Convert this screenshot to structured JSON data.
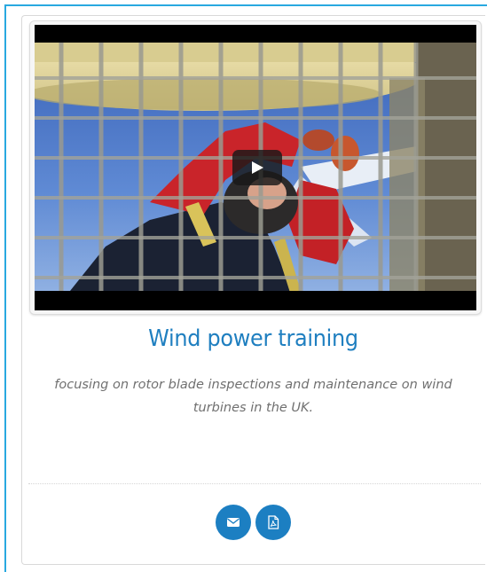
{
  "card": {
    "title": "Wind power training",
    "description": "focusing on rotor blade inspections and maintenance on wind turbines in the UK."
  },
  "video": {
    "play_icon": "play-icon"
  },
  "actions": {
    "email_icon": "envelope-icon",
    "pdf_icon": "pdf-file-icon"
  },
  "colors": {
    "accent": "#1c7fc2",
    "title": "#1f7fc0",
    "frame_border": "#29a9e0",
    "description": "#707070"
  }
}
